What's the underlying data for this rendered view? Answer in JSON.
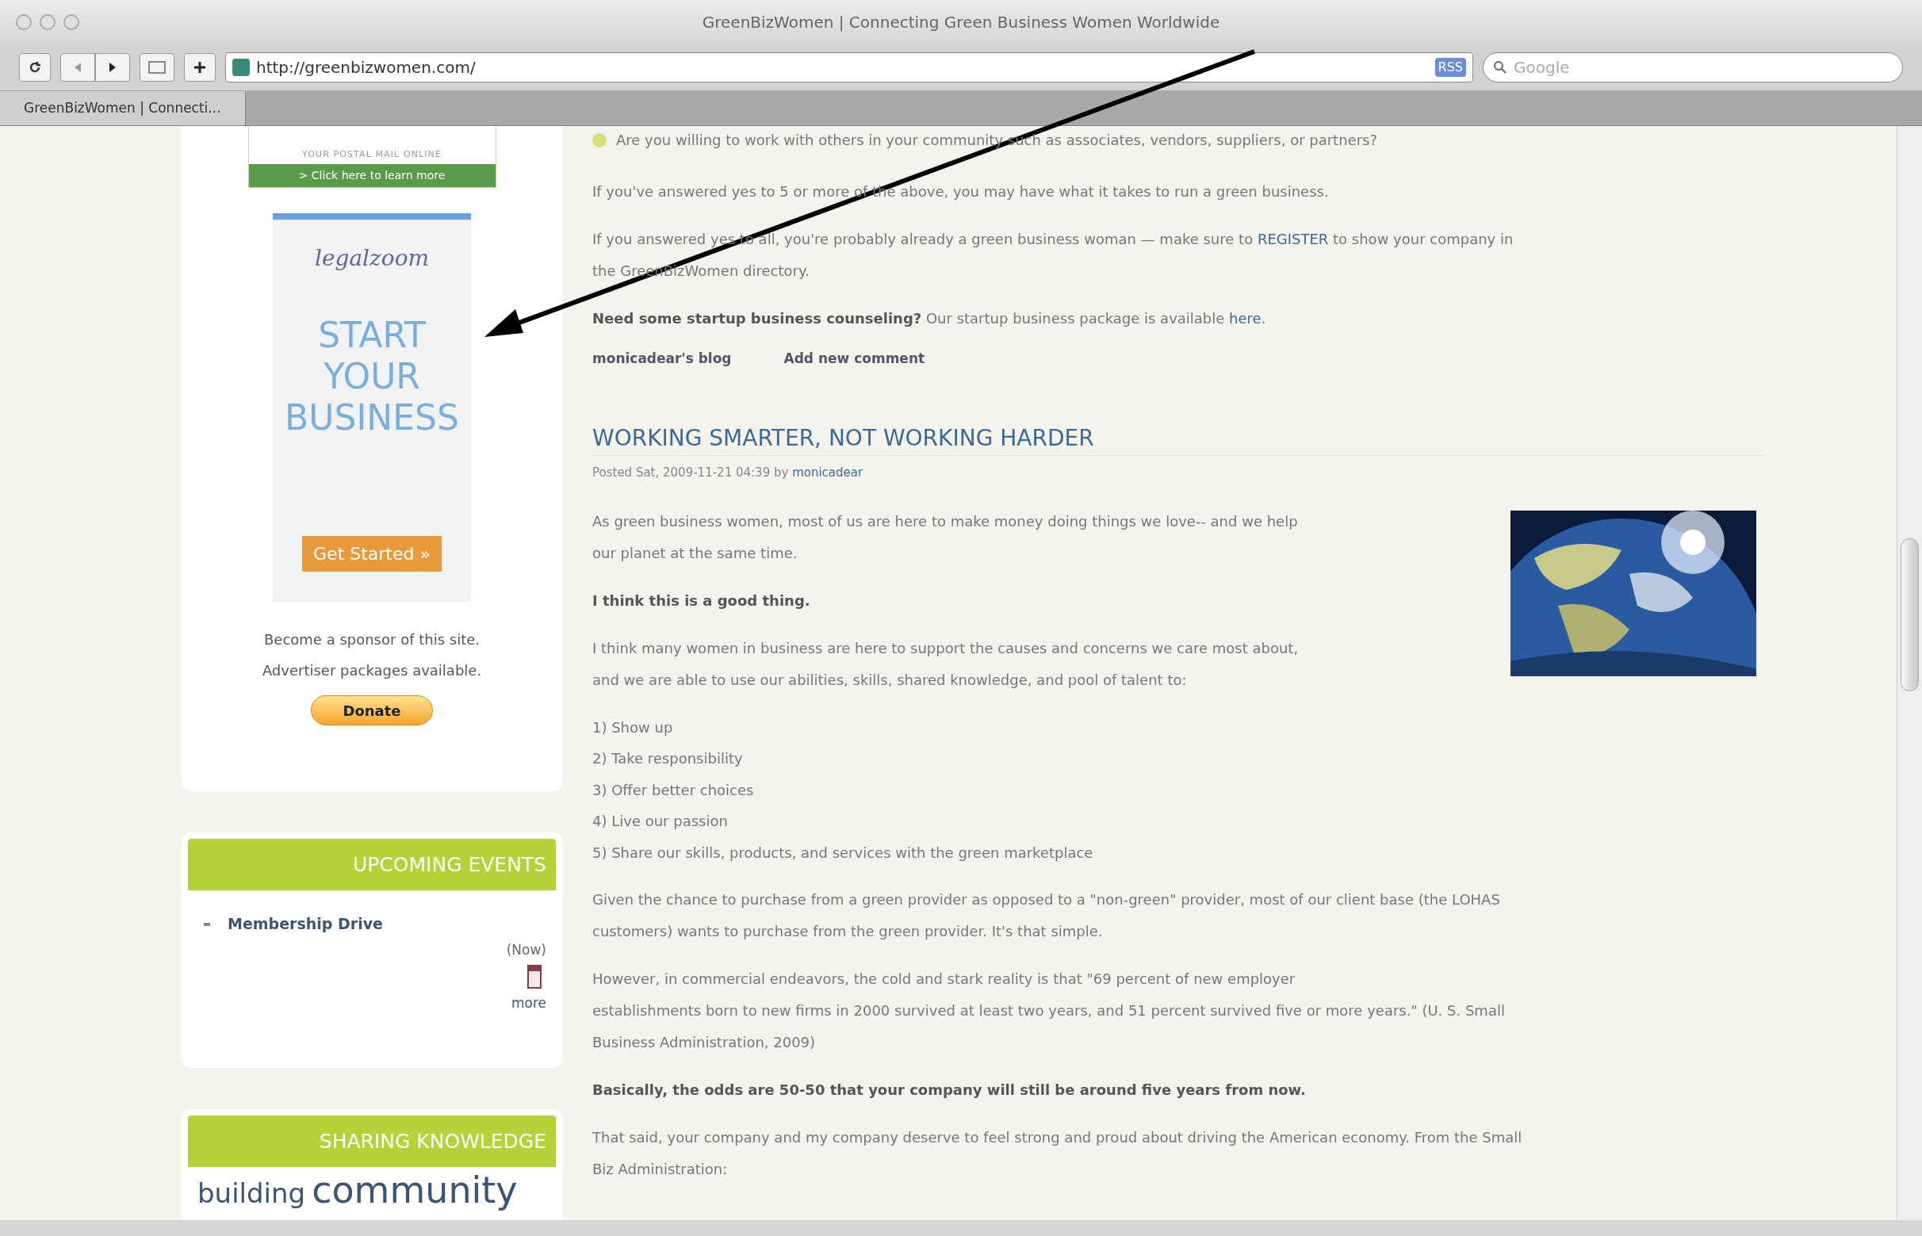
{
  "window": {
    "title": "GreenBizWomen | Connecting Green Business Women Worldwide"
  },
  "toolbar": {
    "url": "http://greenbizwomen.com/",
    "rss": "RSS",
    "search_placeholder": "Google"
  },
  "tabs": [
    {
      "label": "GreenBizWomen | Connecti...",
      "selected": true
    }
  ],
  "sidebar": {
    "postal_ad": {
      "tagline": "YOUR POSTAL MAIL ONLINE",
      "link": "> Click here to learn more"
    },
    "legal_ad": {
      "logo": "legalzoom",
      "headline": [
        "START",
        "YOUR",
        "BUSINESS"
      ],
      "button": "Get Started »"
    },
    "sponsor_lines": [
      "Become a sponsor of this site.",
      "Advertiser packages available."
    ],
    "donate": "Donate",
    "events": {
      "title": "UPCOMING EVENTS",
      "items": [
        {
          "name": "Membership Drive",
          "when": "(Now)"
        }
      ],
      "more": "more"
    },
    "knowledge": {
      "title": "SHARING KNOWLEDGE",
      "banner_small": "building",
      "banner_large": "community"
    }
  },
  "article_top": [
    {
      "kind": "check",
      "segments": [
        {
          "kind": "plain",
          "text": "Are you willing to work with others in your community such as associates, vendors, suppliers, or partners?"
        }
      ]
    },
    {
      "kind": "para",
      "segments": [
        {
          "kind": "plain",
          "text": "If you've answered yes to 5 or more of the above, you may have what it takes to run a green business."
        }
      ]
    },
    {
      "kind": "para",
      "segments": [
        {
          "kind": "plain",
          "text": "If you answered yes to all, you're probably already a green business woman — make sure to "
        },
        {
          "kind": "link",
          "text": "REGISTER"
        },
        {
          "kind": "plain",
          "text": " to show your company in"
        },
        {
          "kind": "break"
        },
        {
          "kind": "plain",
          "text": "the GreenBizWomen directory."
        }
      ]
    },
    {
      "kind": "para",
      "segments": [
        {
          "kind": "bold",
          "text": "Need some startup business counseling?"
        },
        {
          "kind": "plain",
          "text": " Our startup business package is available "
        },
        {
          "kind": "link",
          "text": "here"
        },
        {
          "kind": "plain",
          "text": "."
        }
      ]
    }
  ],
  "article_links": [
    "monicadear's blog",
    "Add new comment"
  ],
  "post": {
    "title": "WORKING SMARTER, NOT WORKING HARDER",
    "meta": "Posted Sat, 2009-11-21 04:39 by ",
    "author": "monicadear",
    "paragraphs": [
      {
        "kind": "para",
        "segments": [
          {
            "kind": "plain",
            "text": "As green business women, most of us are here to make money doing things we love-- and we help"
          },
          {
            "kind": "break"
          },
          {
            "kind": "plain",
            "text": "our planet at the same time."
          }
        ]
      },
      {
        "kind": "para",
        "segments": [
          {
            "kind": "bold",
            "text": "I think this is a good thing."
          }
        ]
      },
      {
        "kind": "para",
        "segments": [
          {
            "kind": "plain",
            "text": "I think many women in business are here to support the causes and concerns we care most about,"
          },
          {
            "kind": "break"
          },
          {
            "kind": "plain",
            "text": "and we are able to use our abilities, skills, shared knowledge, and pool of talent to:"
          }
        ]
      },
      {
        "kind": "list",
        "items": [
          "1) Show up",
          "2) Take responsibility",
          "3) Offer better choices",
          "4) Live our passion",
          "5) Share our skills, products, and services with the green marketplace"
        ]
      },
      {
        "kind": "para",
        "segments": [
          {
            "kind": "plain",
            "text": "Given the chance to purchase from a green provider as opposed to a \"non-green\" provider, most of our client base (the LOHAS"
          },
          {
            "kind": "break"
          },
          {
            "kind": "plain",
            "text": "customers) wants to purchase from the green provider. It's that simple."
          }
        ]
      },
      {
        "kind": "para",
        "segments": [
          {
            "kind": "plain",
            "text": "However, in commercial endeavors, the cold and stark reality is that \"69 percent of new employer"
          },
          {
            "kind": "break"
          },
          {
            "kind": "plain",
            "text": "establishments born to new firms in 2000 survived at least two years, and 51 percent survived five or more years.\" (U. S. Small"
          },
          {
            "kind": "break"
          },
          {
            "kind": "plain",
            "text": "Business Administration, 2009)"
          }
        ]
      },
      {
        "kind": "para",
        "segments": [
          {
            "kind": "bold",
            "text": "Basically, the odds are 50-50 that your company will still be around five years from now."
          }
        ]
      },
      {
        "kind": "para",
        "segments": [
          {
            "kind": "plain",
            "text": "That said, your company and my company deserve to feel strong and proud about driving the American economy. From the Small"
          },
          {
            "kind": "break"
          },
          {
            "kind": "plain",
            "text": "Biz Administration:"
          }
        ]
      }
    ]
  }
}
